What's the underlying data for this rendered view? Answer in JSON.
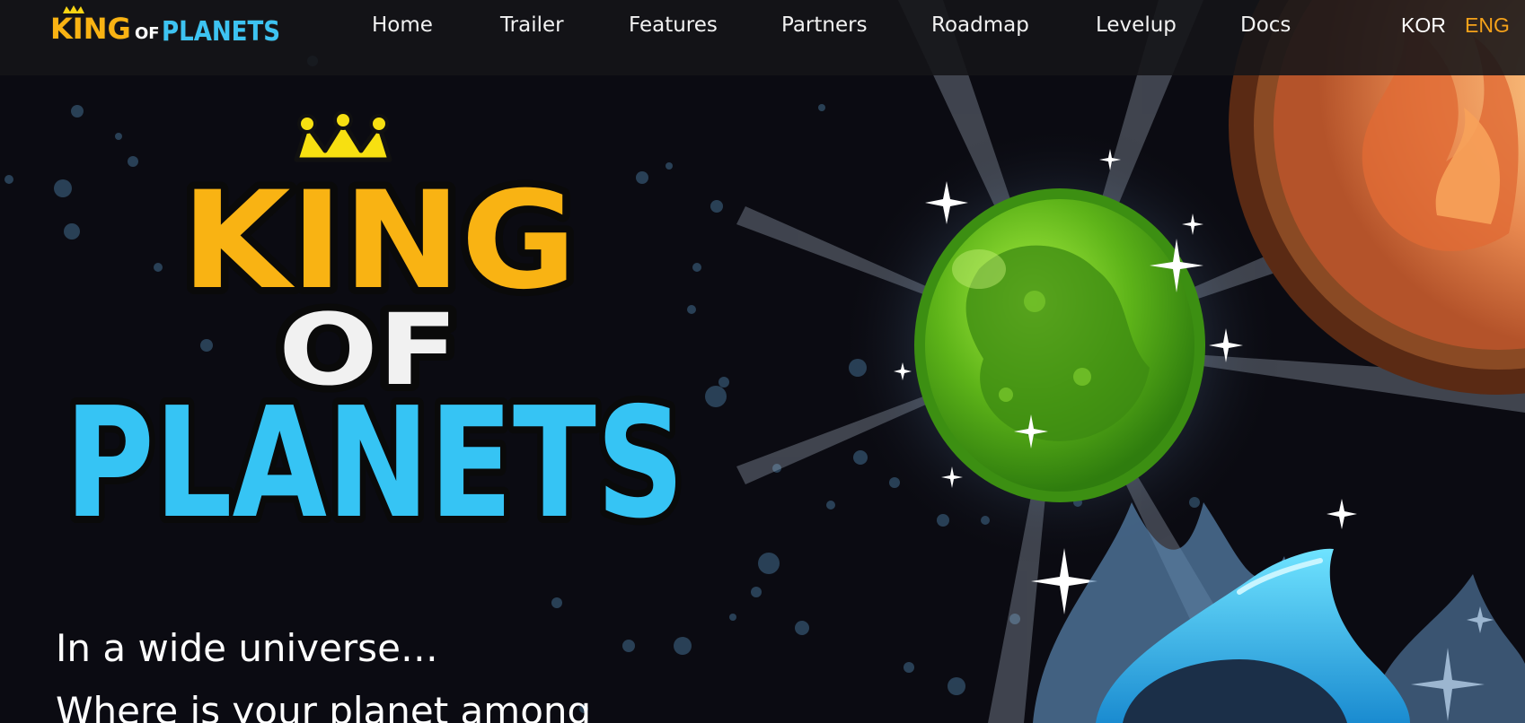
{
  "brand": {
    "logo_text_top": "KING",
    "logo_text_mid": "OF",
    "logo_text_bottom": "PLANETS"
  },
  "nav": {
    "items": [
      {
        "label": "Home"
      },
      {
        "label": "Trailer"
      },
      {
        "label": "Features"
      },
      {
        "label": "Partners"
      },
      {
        "label": "Roadmap"
      },
      {
        "label": "Levelup"
      },
      {
        "label": "Docs"
      }
    ],
    "lang": [
      {
        "label": "KOR",
        "color": "#ffffff"
      },
      {
        "label": "ENG",
        "color": "#f5a21a"
      }
    ]
  },
  "hero": {
    "title_top": "KING",
    "title_mid": "OF",
    "title_bottom": "PLANETS",
    "line1": "In a wide universe…",
    "line2": "Where is your planet among"
  },
  "colors": {
    "background": "#0b0b12",
    "title_orange": "#f9b313",
    "title_white": "#f1f1f1",
    "title_blue": "#36c4f4",
    "planet_green": "#6cc31a",
    "fire_orange": "#e3733a",
    "ice_blue": "#35d0f4"
  }
}
